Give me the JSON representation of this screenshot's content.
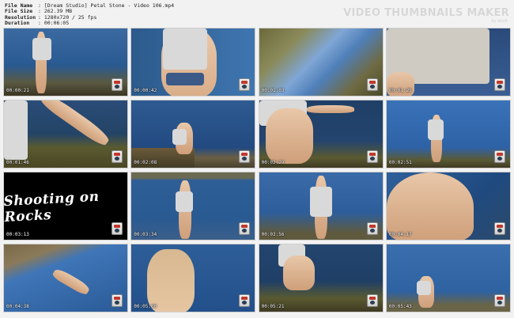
{
  "header": {
    "file_name_label": "File Name",
    "file_name": "[Dream Studio] Petal Stone - Video 106.mp4",
    "file_size_label": "File Size",
    "file_size": "262.39 MB",
    "resolution_label": "Resolution",
    "resolution": "1280x720 / 25 fps",
    "duration_label": "Duration",
    "duration": "00:06:05"
  },
  "brand": "VIDEO THUMBNAILS MAKER",
  "brand_sub": "by xboft",
  "title_card_text": "Shooting on Rocks",
  "thumbnails": [
    {
      "ts": "00:00:21"
    },
    {
      "ts": "00:00:42"
    },
    {
      "ts": "00:01:03"
    },
    {
      "ts": "00:01:25"
    },
    {
      "ts": "00:01:46"
    },
    {
      "ts": "00:02:08"
    },
    {
      "ts": "00:02:29"
    },
    {
      "ts": "00:02:51"
    },
    {
      "ts": "00:03:13"
    },
    {
      "ts": "00:03:34"
    },
    {
      "ts": "00:03:56"
    },
    {
      "ts": "00:04:17"
    },
    {
      "ts": "00:04:38"
    },
    {
      "ts": "00:05:00"
    },
    {
      "ts": "00:05:21"
    },
    {
      "ts": "00:05:43"
    }
  ]
}
